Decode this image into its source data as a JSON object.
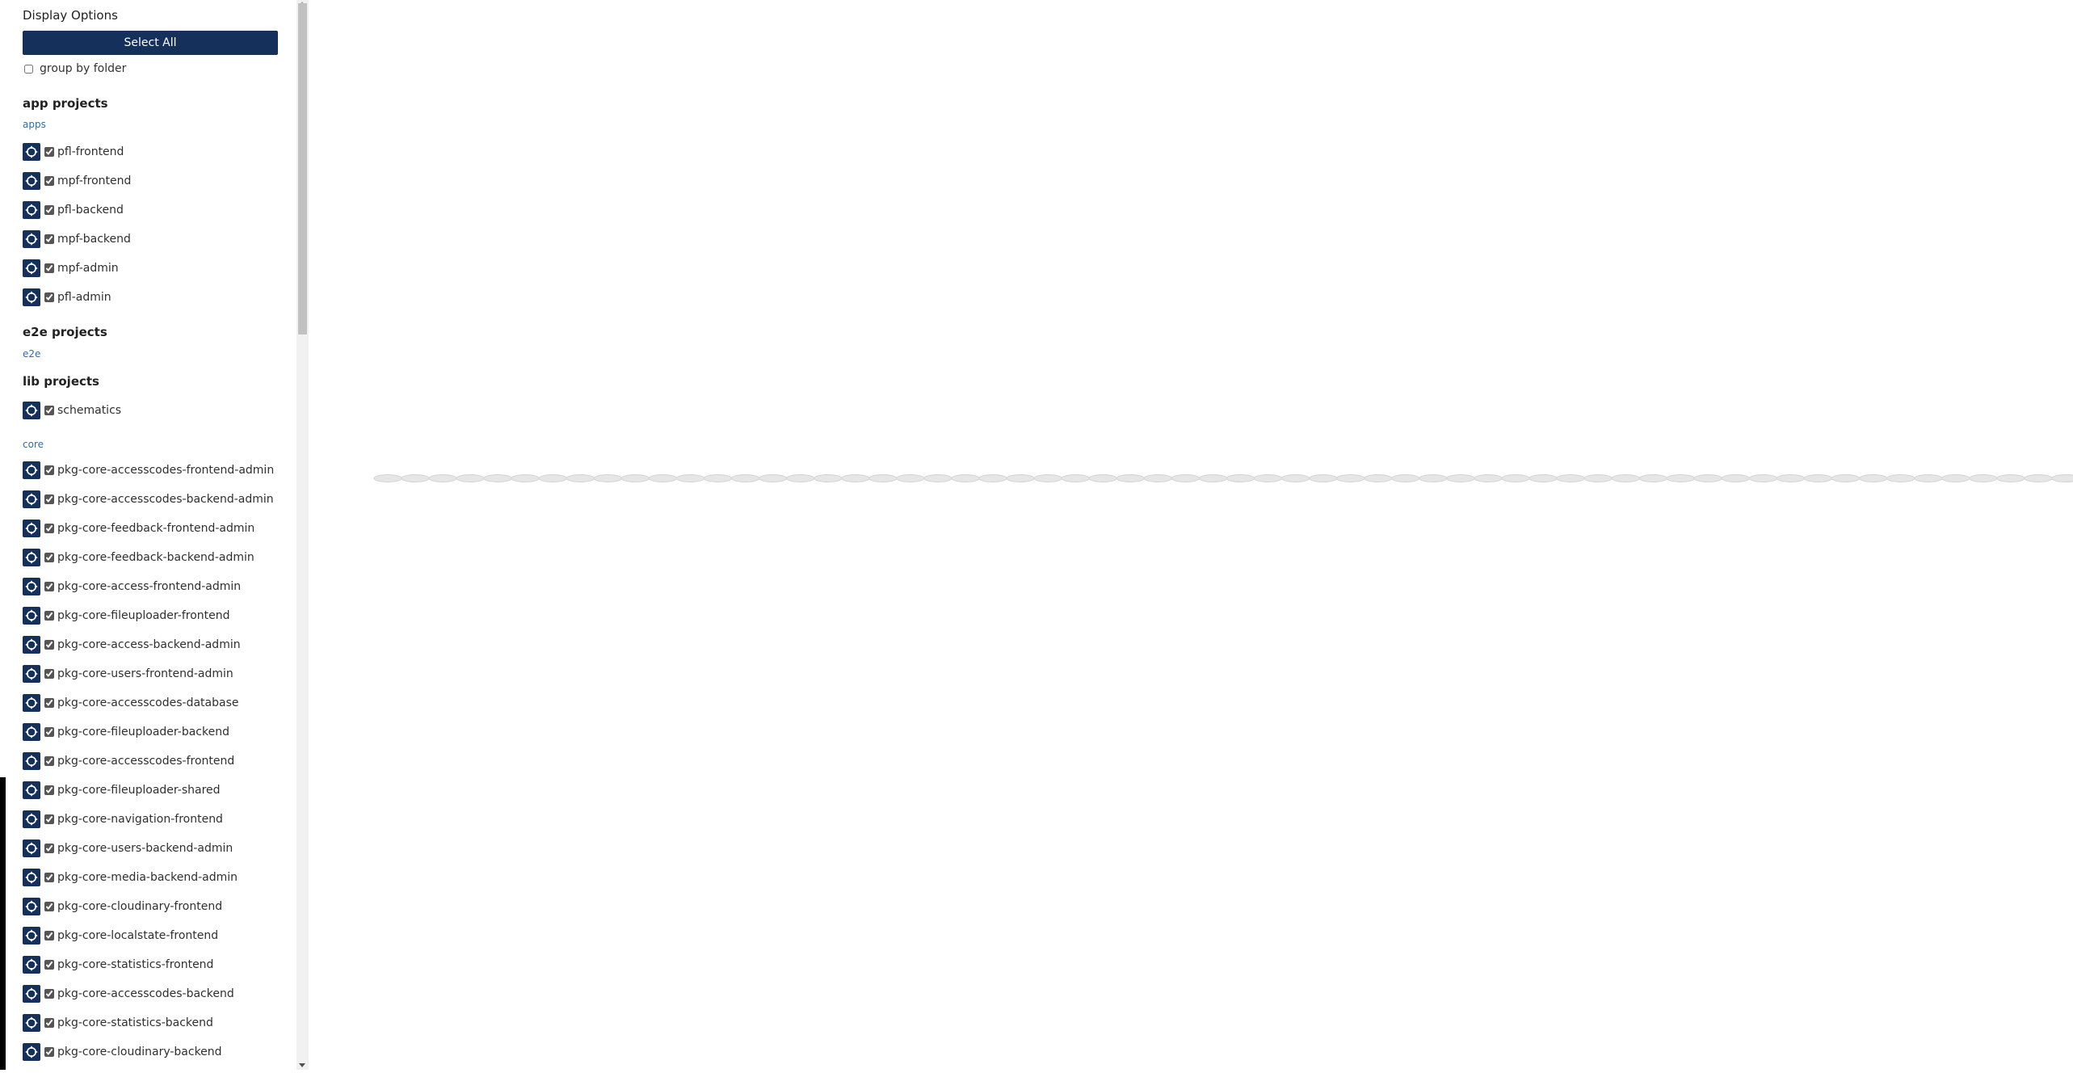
{
  "sidebar": {
    "display_options_title": "Display Options",
    "select_all_label": "Select All",
    "group_by_folder_label": "group by folder",
    "app_projects_title": "app projects",
    "apps_folder_label": "apps",
    "apps": [
      {
        "label": "pfl-frontend"
      },
      {
        "label": "mpf-frontend"
      },
      {
        "label": "pfl-backend"
      },
      {
        "label": "mpf-backend"
      },
      {
        "label": "mpf-admin"
      },
      {
        "label": "pfl-admin"
      }
    ],
    "e2e_projects_title": "e2e projects",
    "e2e_folder_label": "e2e",
    "lib_projects_title": "lib projects",
    "lib_root": [
      {
        "label": "schematics"
      }
    ],
    "core_folder_label": "core",
    "core": [
      {
        "label": "pkg-core-accesscodes-frontend-admin"
      },
      {
        "label": "pkg-core-accesscodes-backend-admin"
      },
      {
        "label": "pkg-core-feedback-frontend-admin"
      },
      {
        "label": "pkg-core-feedback-backend-admin"
      },
      {
        "label": "pkg-core-access-frontend-admin"
      },
      {
        "label": "pkg-core-fileuploader-frontend"
      },
      {
        "label": "pkg-core-access-backend-admin"
      },
      {
        "label": "pkg-core-users-frontend-admin"
      },
      {
        "label": "pkg-core-accesscodes-database"
      },
      {
        "label": "pkg-core-fileuploader-backend"
      },
      {
        "label": "pkg-core-accesscodes-frontend"
      },
      {
        "label": "pkg-core-fileuploader-shared"
      },
      {
        "label": "pkg-core-navigation-frontend"
      },
      {
        "label": "pkg-core-users-backend-admin"
      },
      {
        "label": "pkg-core-media-backend-admin"
      },
      {
        "label": "pkg-core-cloudinary-frontend"
      },
      {
        "label": "pkg-core-localstate-frontend"
      },
      {
        "label": "pkg-core-statistics-frontend"
      },
      {
        "label": "pkg-core-accesscodes-backend"
      },
      {
        "label": "pkg-core-statistics-backend"
      },
      {
        "label": "pkg-core-cloudinary-backend"
      }
    ]
  },
  "graph": {
    "node_count": 62,
    "node_color": "#e6e6e6"
  },
  "colors": {
    "accent": "#15305a",
    "folder_link": "#2b6cb0"
  }
}
